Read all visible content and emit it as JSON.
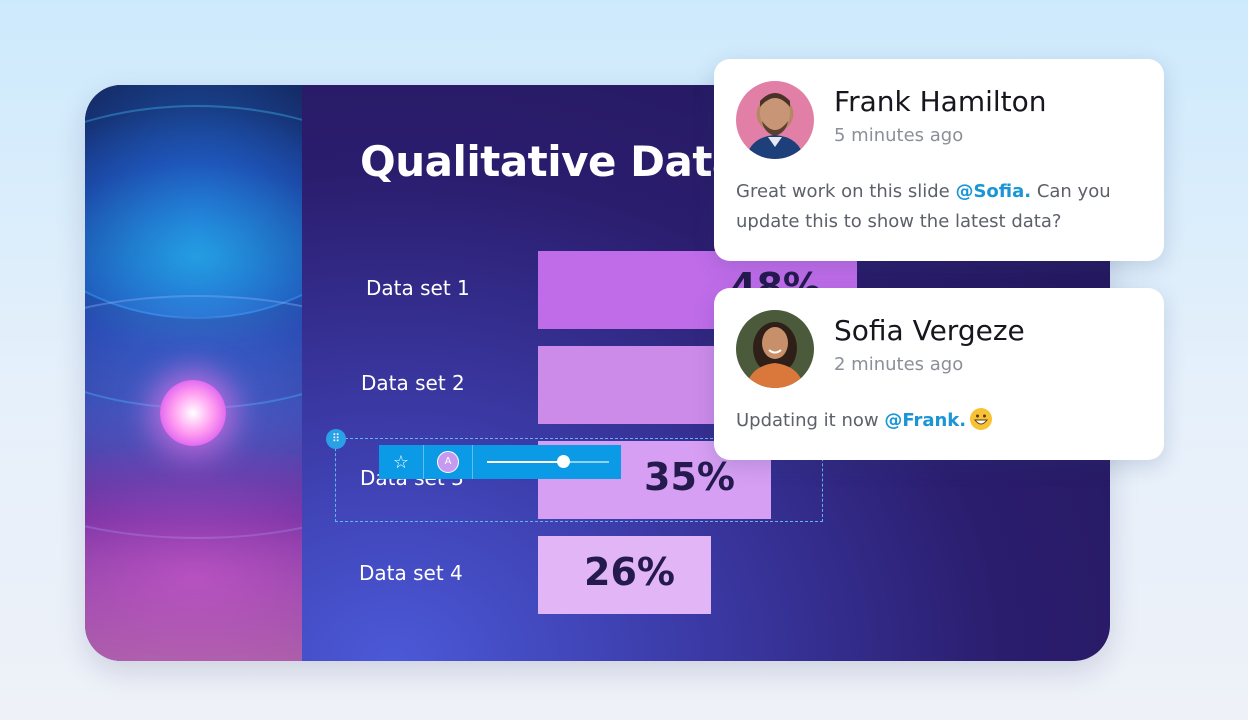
{
  "slide": {
    "title": "Qualitative Data",
    "rows": [
      {
        "label": "Data set 1",
        "value": "48%",
        "percent": 48,
        "color": "#c06ce9"
      },
      {
        "label": "Data set 2",
        "value": "",
        "percent": 43,
        "color": "#cd8be9"
      },
      {
        "label": "Data set 3",
        "value": "35%",
        "percent": 35,
        "color": "#d79ff3"
      },
      {
        "label": "Data set 4",
        "value": "26%",
        "percent": 26,
        "color": "#e2b5f6"
      }
    ]
  },
  "selection": {
    "handle_icon": "grip-dots-icon"
  },
  "toolbar": {
    "star_icon": "star-icon",
    "avatar_initial": "A",
    "slider_level": 0.62
  },
  "comments": [
    {
      "name": "Frank Hamilton",
      "time": "5 minutes ago",
      "text_before": "Great work on this slide ",
      "mention": "@Sofia.",
      "text_after": " Can you update this to show the latest data?",
      "avatar_bg": "#e27fa6"
    },
    {
      "name": "Sofia Vergeze",
      "time": "2 minutes ago",
      "text_before": "Updating it now ",
      "mention": "@Frank.",
      "text_after": "",
      "emoji": "grinning-face-emoji",
      "avatar_bg": "#4a5a3a"
    }
  ],
  "colors": {
    "accent": "#0a9ae6",
    "mention": "#1a96d6"
  }
}
